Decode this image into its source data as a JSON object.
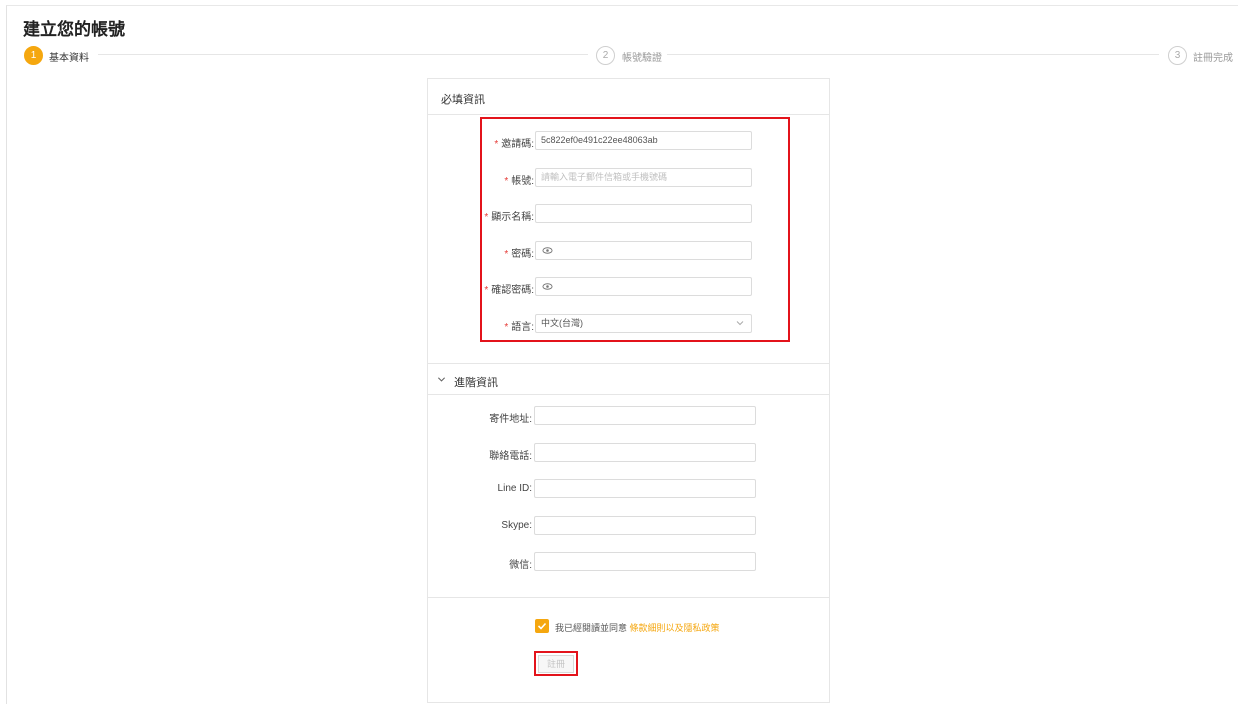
{
  "page": {
    "title": "建立您的帳號"
  },
  "steps": [
    {
      "number": "1",
      "label": "基本資料"
    },
    {
      "number": "2",
      "label": "帳號驗證"
    },
    {
      "number": "3",
      "label": "註冊完成"
    }
  ],
  "required_section": {
    "title": "必填資訊",
    "fields": [
      {
        "label": "邀請碼:",
        "value": "5c822ef0e491c22ee48063ab",
        "placeholder": ""
      },
      {
        "label": "帳號:",
        "value": "",
        "placeholder": "請輸入電子郵件信箱或手機號碼"
      },
      {
        "label": "顯示名稱:",
        "value": "",
        "placeholder": ""
      },
      {
        "label": "密碼:",
        "value": "",
        "placeholder": ""
      },
      {
        "label": "確認密碼:",
        "value": "",
        "placeholder": ""
      },
      {
        "label": "語言:",
        "value": "中文(台灣)",
        "placeholder": ""
      }
    ]
  },
  "advanced_section": {
    "title": "進階資訊",
    "fields": [
      {
        "label": "寄件地址:",
        "value": ""
      },
      {
        "label": "聯絡電話:",
        "value": ""
      },
      {
        "label": "Line ID:",
        "value": ""
      },
      {
        "label": "Skype:",
        "value": ""
      },
      {
        "label": "微信:",
        "value": ""
      }
    ]
  },
  "agreement": {
    "text": "我已經閱讀並同意",
    "link": "條款細則以及隱私政策",
    "checked": true
  },
  "register_button": {
    "label": "註冊"
  },
  "colors": {
    "accent": "#f5a70f",
    "required": "#e53935",
    "highlight": "#e3131b"
  },
  "icons": {
    "password": "eye-icon",
    "select": "chevron-down-icon",
    "section_toggle": "chevron-down-icon",
    "check": "checkmark-icon"
  }
}
